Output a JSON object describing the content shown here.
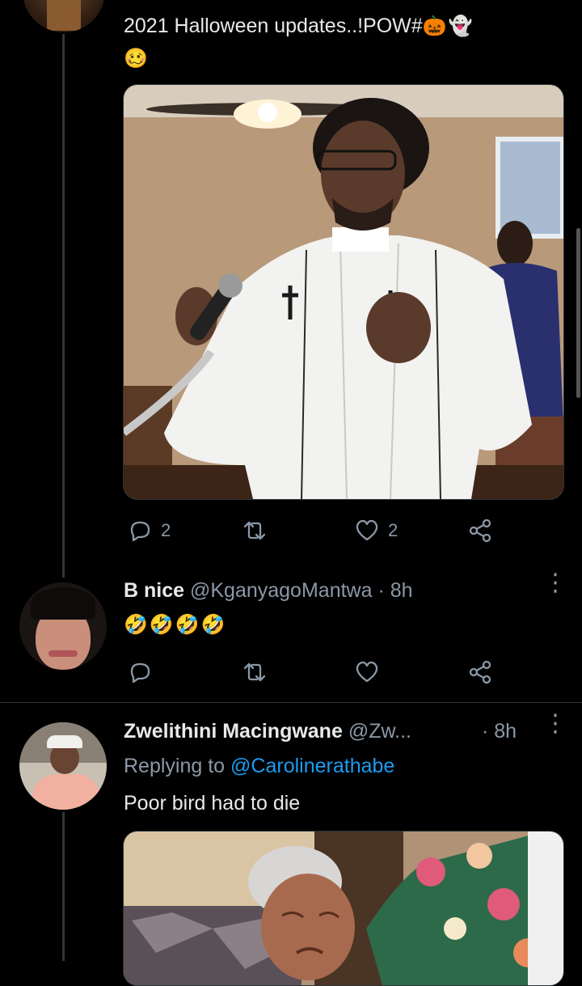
{
  "tweet1": {
    "text": "2021 Halloween updates..!POW#",
    "emoji_inline": "🎃👻",
    "emoji_line2": "🥴",
    "media_alt": "Man in white preacher robe speaking at a microphone in a church",
    "actions": {
      "replies": "2",
      "retweets": "",
      "likes": "2"
    }
  },
  "reply1": {
    "name": "B nice",
    "handle": "@KganyagoMantwa",
    "sep": "·",
    "time": "8h",
    "text": "🤣🤣🤣🤣"
  },
  "reply2": {
    "name": "Zwelithini Macingwane",
    "handle": "@Zw...",
    "sep": "·",
    "time": "8h",
    "replying_prefix": "Replying to",
    "replying_handle": "@Carolinerathabe",
    "text": "Poor bird had to die",
    "media_alt": "Elderly woman crying while another person in floral shirt consoles her"
  },
  "icons": {
    "reply": "reply-icon",
    "retweet": "retweet-icon",
    "like": "heart-icon",
    "share": "share-icon",
    "more": "more-icon"
  },
  "colors": {
    "background": "#000000",
    "text": "#e7e9ea",
    "muted": "#8b98a5",
    "link": "#1d9bf0"
  }
}
